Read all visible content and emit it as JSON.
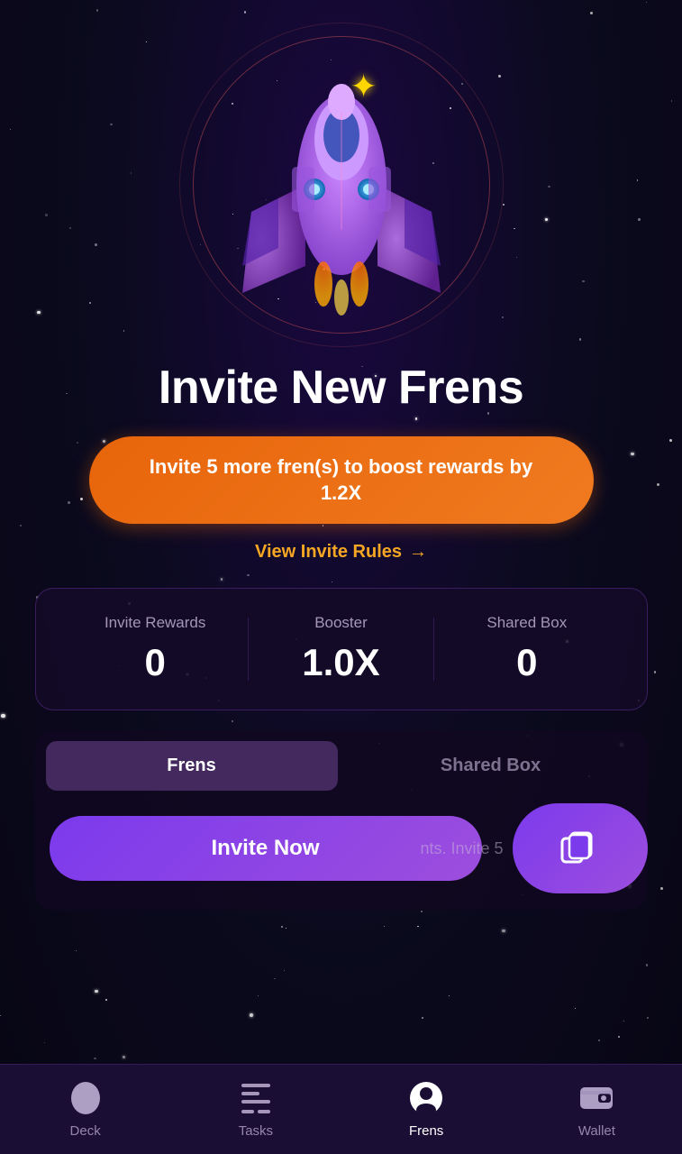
{
  "page": {
    "title": "Invite New Frens"
  },
  "hero": {
    "title": "Invite New Frens",
    "boost_button_text": "Invite 5 more fren(s) to boost rewards by 1.2X",
    "view_rules_text": "View Invite Rules",
    "arrow": "→"
  },
  "stats": {
    "invite_rewards_label": "Invite Rewards",
    "invite_rewards_value": "0",
    "booster_label": "Booster",
    "booster_value": "1.0X",
    "shared_box_label": "Shared Box",
    "shared_box_value": "0"
  },
  "tabs": {
    "frens_label": "Frens",
    "shared_box_label": "Shared Box"
  },
  "invite": {
    "invite_now_label": "Invite Now",
    "faded_text": "nts. Invite 5"
  },
  "nav": {
    "deck_label": "Deck",
    "tasks_label": "Tasks",
    "frens_label": "Frens",
    "wallet_label": "Wallet"
  }
}
